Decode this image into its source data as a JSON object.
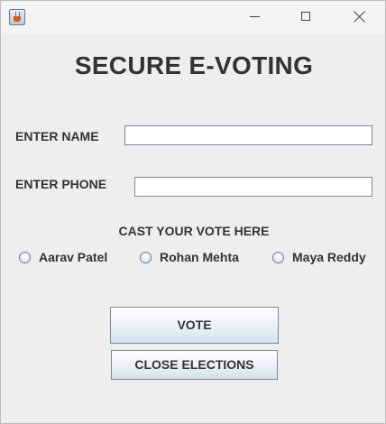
{
  "window": {
    "title": "",
    "controls": {
      "minimize_icon": "minimize-icon",
      "maximize_icon": "maximize-icon",
      "close_icon": "close-icon"
    }
  },
  "form": {
    "heading": "SECURE E-VOTING",
    "name_label": "ENTER NAME",
    "name_value": "",
    "phone_label": "ENTER PHONE",
    "phone_value": "",
    "vote_prompt": "CAST YOUR VOTE HERE",
    "candidates": [
      {
        "label": "Aarav Patel",
        "selected": false
      },
      {
        "label": "Rohan Mehta",
        "selected": false
      },
      {
        "label": "Maya Reddy",
        "selected": false
      }
    ],
    "vote_button": "VOTE",
    "close_button": "CLOSE ELECTIONS"
  },
  "colors": {
    "window_bg": "#eeeeee",
    "text": "#333333",
    "button_gradient_bottom": "#d6e1ec"
  }
}
